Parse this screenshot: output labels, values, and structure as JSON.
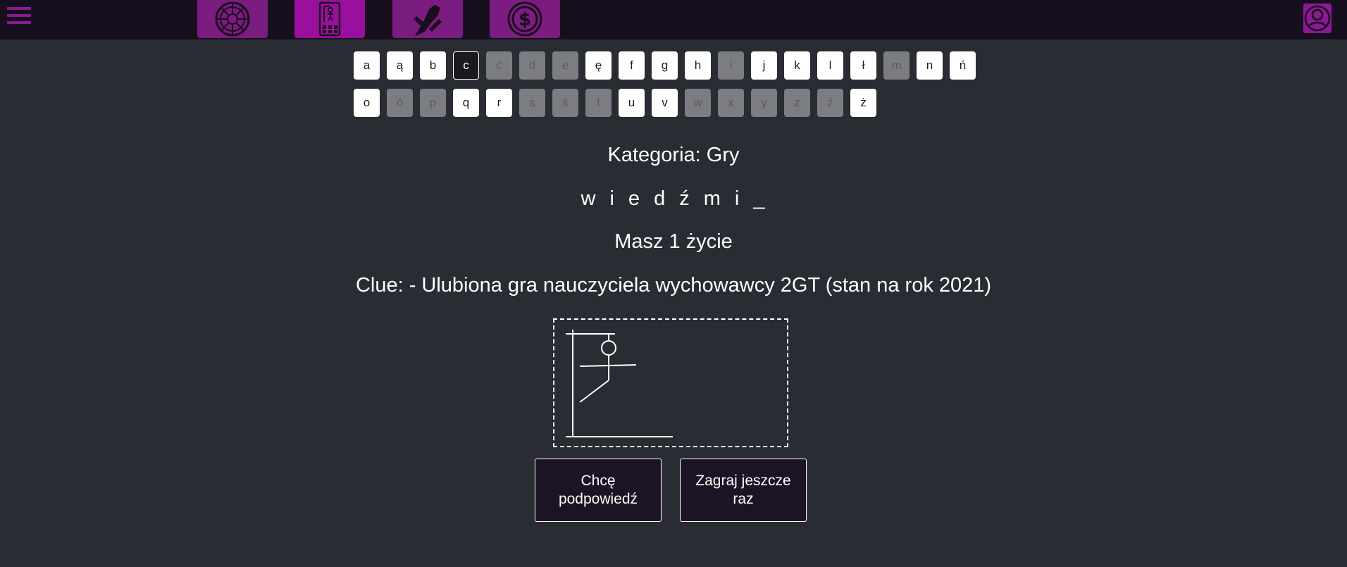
{
  "topbar": {
    "menu_icon": "hamburger-menu-icon",
    "tabs": [
      {
        "name": "roulette",
        "icon": "roulette-wheel-icon",
        "bg": "#7a1c80"
      },
      {
        "name": "hangman",
        "icon": "hangman-card-icon",
        "bg": "#9a0f9c"
      },
      {
        "name": "rock-paper-scissors",
        "icon": "scissors-hand-icon",
        "bg": "#7a1c80"
      },
      {
        "name": "money",
        "icon": "dollar-coin-icon",
        "bg": "#7a1c80"
      }
    ],
    "avatar_icon": "user-avatar-icon"
  },
  "keyboard": {
    "rows": [
      [
        {
          "letter": "a",
          "state": "avail"
        },
        {
          "letter": "ą",
          "state": "avail"
        },
        {
          "letter": "b",
          "state": "avail"
        },
        {
          "letter": "c",
          "state": "selected"
        },
        {
          "letter": "ć",
          "state": "used"
        },
        {
          "letter": "d",
          "state": "used"
        },
        {
          "letter": "e",
          "state": "used"
        },
        {
          "letter": "ę",
          "state": "avail"
        },
        {
          "letter": "f",
          "state": "avail"
        },
        {
          "letter": "g",
          "state": "avail"
        },
        {
          "letter": "h",
          "state": "avail"
        },
        {
          "letter": "i",
          "state": "used"
        },
        {
          "letter": "j",
          "state": "avail"
        },
        {
          "letter": "k",
          "state": "avail"
        },
        {
          "letter": "l",
          "state": "avail"
        },
        {
          "letter": "ł",
          "state": "avail"
        },
        {
          "letter": "m",
          "state": "used"
        },
        {
          "letter": "n",
          "state": "avail"
        },
        {
          "letter": "ń",
          "state": "avail"
        }
      ],
      [
        {
          "letter": "o",
          "state": "avail"
        },
        {
          "letter": "ó",
          "state": "used"
        },
        {
          "letter": "p",
          "state": "used"
        },
        {
          "letter": "q",
          "state": "avail"
        },
        {
          "letter": "r",
          "state": "avail"
        },
        {
          "letter": "s",
          "state": "used"
        },
        {
          "letter": "ś",
          "state": "used"
        },
        {
          "letter": "t",
          "state": "used"
        },
        {
          "letter": "u",
          "state": "avail"
        },
        {
          "letter": "v",
          "state": "avail"
        },
        {
          "letter": "w",
          "state": "used"
        },
        {
          "letter": "x",
          "state": "used"
        },
        {
          "letter": "y",
          "state": "used"
        },
        {
          "letter": "z",
          "state": "used"
        },
        {
          "letter": "ź",
          "state": "used"
        },
        {
          "letter": "ż",
          "state": "avail"
        }
      ]
    ]
  },
  "game": {
    "category": "Kategoria: Gry",
    "word_letters": [
      "w",
      "i",
      "e",
      "d",
      "ź",
      "m",
      "i",
      "_"
    ],
    "lives": "Masz 1 życie",
    "clue": "Clue: - Ulubiona gra nauczyciela wychowawcy 2GT (stan na rok 2021)"
  },
  "buttons": {
    "hint": "Chcę podpowiedź",
    "replay": "Zagraj jeszcze raz"
  }
}
